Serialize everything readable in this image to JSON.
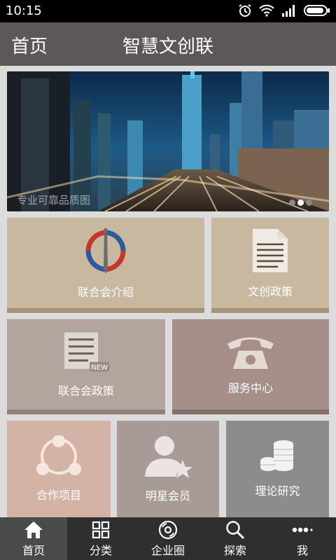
{
  "status": {
    "time": "10:15"
  },
  "appbar": {
    "home_label": "首页",
    "title": "智慧文创联"
  },
  "banner": {
    "caption": "专业可靠品质图",
    "page_count": 3,
    "active_index": 1
  },
  "tiles": [
    {
      "label": "联合会介绍",
      "icon": "federation-emblem-icon"
    },
    {
      "label": "文创政策",
      "icon": "document-icon"
    },
    {
      "label": "联合会政策",
      "icon": "new-document-icon"
    },
    {
      "label": "服务中心",
      "icon": "telephone-icon"
    },
    {
      "label": "合作项目",
      "icon": "network-icon"
    },
    {
      "label": "明星会员",
      "icon": "star-member-icon"
    },
    {
      "label": "理论研究",
      "icon": "coins-icon"
    }
  ],
  "tabs": [
    {
      "label": "首页",
      "icon": "home-icon",
      "active": true
    },
    {
      "label": "分类",
      "icon": "grid-icon",
      "active": false
    },
    {
      "label": "企业圈",
      "icon": "disc-icon",
      "active": false
    },
    {
      "label": "探索",
      "icon": "search-icon",
      "active": false
    },
    {
      "label": "我",
      "icon": "more-icon",
      "active": false
    }
  ],
  "colors": {
    "appbar": "#5b5857",
    "tile_beige": "#c8b8a0",
    "tile_mauve": "#b4a49e",
    "tile_rose": "#a58f88",
    "tile_pink": "#d4b3a7",
    "tile_taupe": "#a89b96",
    "tile_gray": "#8d8c8b",
    "tabbar": "#2f2f2f"
  }
}
